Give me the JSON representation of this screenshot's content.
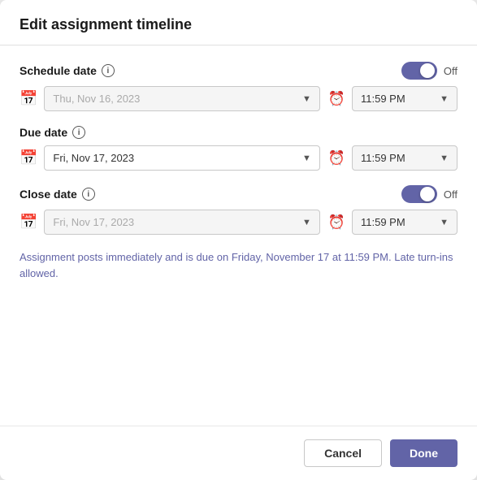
{
  "dialog": {
    "title": "Edit assignment timeline"
  },
  "schedule_date": {
    "label": "Schedule date",
    "toggle_state": "Off",
    "date_value": "Thu, Nov 16, 2023",
    "date_placeholder": "Thu, Nov 16, 2023",
    "time_value": "11:59 PM",
    "disabled": true
  },
  "due_date": {
    "label": "Due date",
    "date_value": "Fri, Nov 17, 2023",
    "time_value": "11:59 PM",
    "disabled": false
  },
  "close_date": {
    "label": "Close date",
    "toggle_state": "Off",
    "date_value": "Fri, Nov 17, 2023",
    "date_placeholder": "Fri, Nov 17, 2023",
    "time_value": "11:59 PM",
    "disabled": true
  },
  "info_text": "Assignment posts immediately and is due on Friday, November 17 at 11:59 PM. Late turn-ins allowed.",
  "footer": {
    "cancel_label": "Cancel",
    "done_label": "Done"
  }
}
